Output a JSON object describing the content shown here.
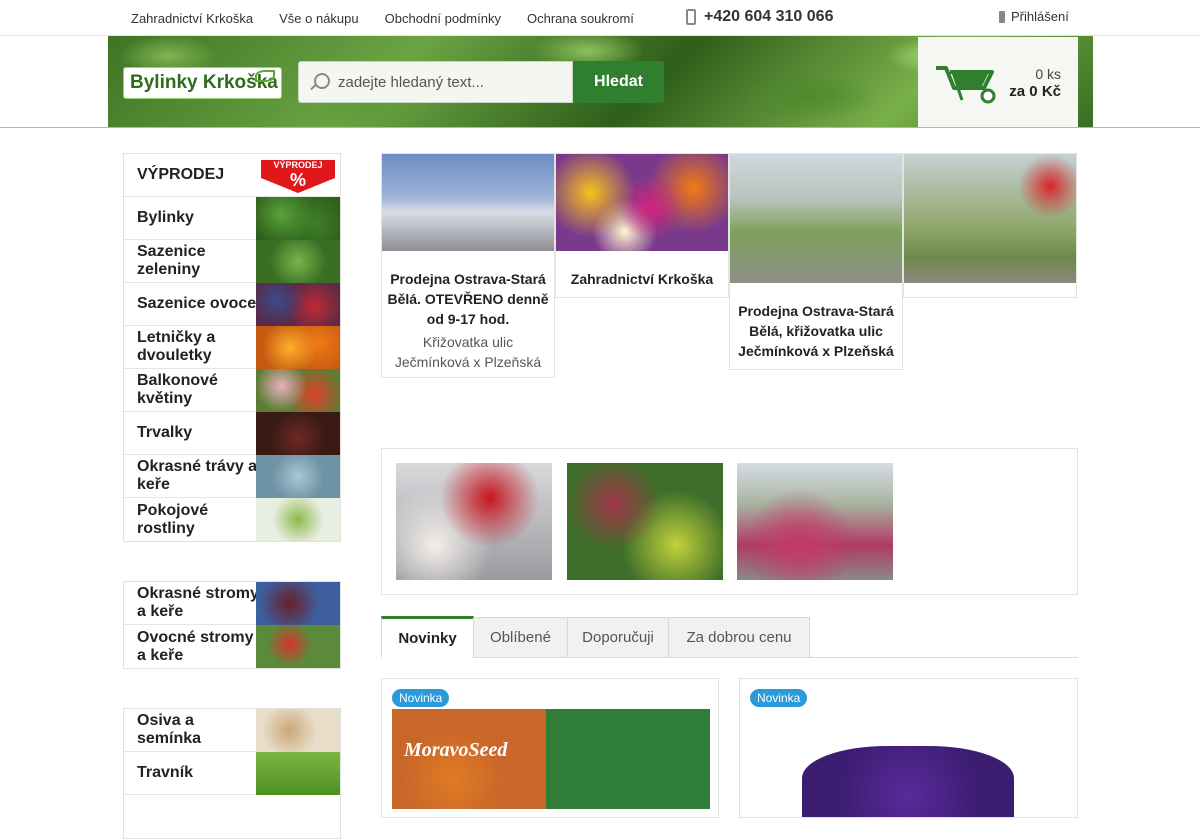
{
  "topnav": [
    "Zahradnictví Krkoška",
    "Vše o nákupu",
    "Obchodní podmínky",
    "Ochrana soukromí"
  ],
  "phone": "+420 604 310 066",
  "login": "Přihlášení",
  "logo": "Bylinky Krkoška",
  "search": {
    "placeholder": "zadejte hledaný text...",
    "button": "Hledat"
  },
  "cart": {
    "count": "0 ks",
    "price": "za 0 Kč"
  },
  "sidebar": {
    "sale": {
      "label": "VÝPRODEJ",
      "badge_text": "VÝPRODEJ",
      "badge_symbol": "%"
    },
    "group1": [
      "Bylinky",
      "Sazenice zeleniny",
      "Sazenice ovoce",
      "Letničky a dvouletky",
      "Balkonové květiny",
      "Trvalky",
      "Okrasné trávy a keře",
      "Pokojové rostliny"
    ],
    "group2": [
      "Okrasné stromy a keře",
      "Ovocné stromy a keře"
    ],
    "group3": [
      "Osiva a semínka",
      "Travník"
    ]
  },
  "stores": [
    {
      "title": "Prodejna Ostrava-Stará Bělá. OTEVŘENO denně od 9-17 hod.",
      "sub": "Křižovatka ulic Ječmínková x Plzeňská"
    },
    {
      "title": "Zahradnictví Krkoška",
      "sub": ""
    },
    {
      "title": "Prodejna Ostrava-Stará Bělá, křižovatka ulic Ječmínková x Plzeňská",
      "sub": ""
    },
    {
      "title": "",
      "sub": ""
    }
  ],
  "tabs": [
    "Novinky",
    "Oblíbené",
    "Doporučuji",
    "Za dobrou cenu"
  ],
  "products": [
    {
      "badge": "Novinka",
      "brand": "MoravoSeed"
    },
    {
      "badge": "Novinka"
    }
  ],
  "colors": {
    "accent": "#2f7f2f",
    "badge": "#2a9ad8",
    "sale": "#e0171b"
  }
}
